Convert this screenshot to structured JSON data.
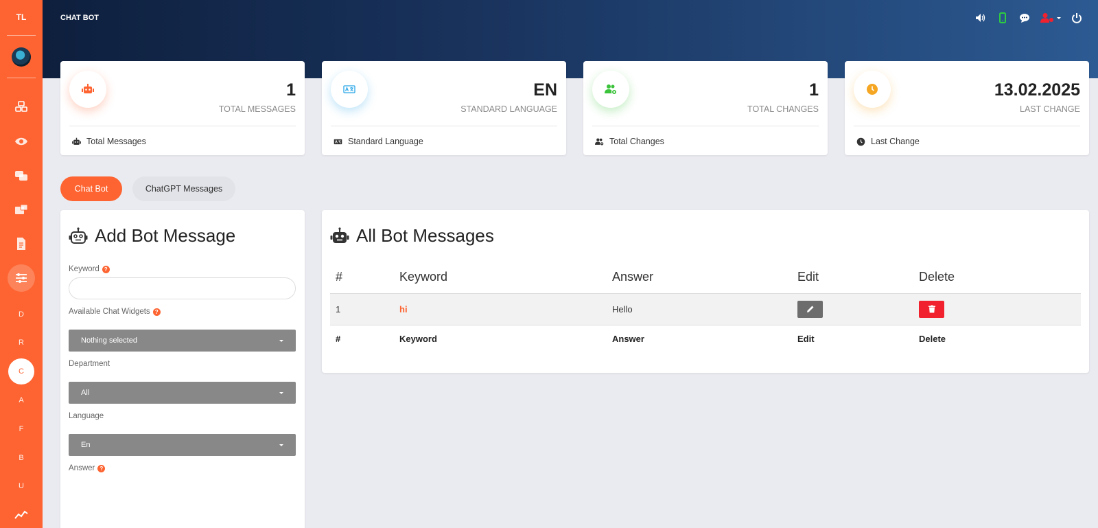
{
  "sidebar": {
    "logo": "TL",
    "icons": [
      "cubes-icon",
      "eye-icon",
      "comments-icon",
      "inbox-icon",
      "document-icon",
      "sliders-icon"
    ],
    "letters": [
      "D",
      "R",
      "C",
      "A",
      "F",
      "B",
      "U"
    ],
    "active_letter": "C"
  },
  "header": {
    "title": "CHAT BOT"
  },
  "stats": [
    {
      "value": "1",
      "label": "TOTAL MESSAGES",
      "footer": "Total Messages",
      "icon": "robot-icon",
      "color": "#fd6431"
    },
    {
      "value": "EN",
      "label": "STANDARD LANGUAGE",
      "footer": "Standard Language",
      "icon": "language-icon",
      "color": "#2aa7e8"
    },
    {
      "value": "1",
      "label": "TOTAL CHANGES",
      "footer": "Total Changes",
      "icon": "users-cog-icon",
      "color": "#3cc33c"
    },
    {
      "value": "13.02.2025",
      "label": "LAST CHANGE",
      "footer": "Last Change",
      "icon": "clock-icon",
      "color": "#f5a623"
    }
  ],
  "tabs": {
    "chat_bot": "Chat Bot",
    "chatgpt": "ChatGPT Messages"
  },
  "add_form": {
    "title": "Add Bot Message",
    "keyword_label": "Keyword",
    "widgets_label": "Available Chat Widgets",
    "widgets_value": "Nothing selected",
    "department_label": "Department",
    "department_value": "All",
    "language_label": "Language",
    "language_value": "En",
    "answer_label": "Answer"
  },
  "messages_table": {
    "title": "All Bot Messages",
    "headers": [
      "#",
      "Keyword",
      "Answer",
      "Edit",
      "Delete"
    ],
    "rows": [
      {
        "num": "1",
        "keyword": "hi",
        "answer": "Hello"
      }
    ]
  },
  "colors": {
    "accent": "#fd6431",
    "delete": "#f2212e",
    "header_start": "#0e1f3d",
    "header_end": "#2c5a92"
  }
}
